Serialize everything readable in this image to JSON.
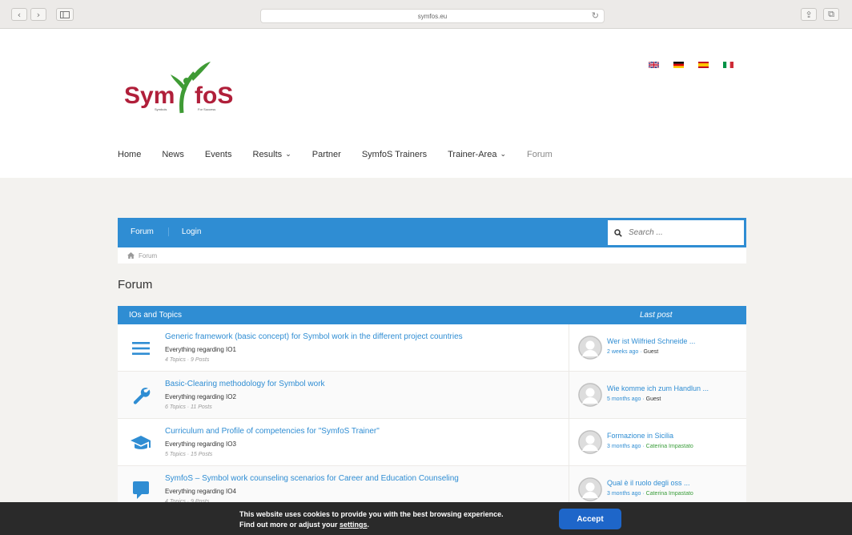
{
  "browser": {
    "url": "symfos.eu",
    "back_glyph": "‹",
    "forward_glyph": "›",
    "reload_glyph": "↻",
    "share_glyph": "⇪",
    "tabs_glyph": "⧉"
  },
  "brand": {
    "logo_text": "SymfoS",
    "logo_sub_left": "Symbols",
    "logo_sub_right": "For Success",
    "colors": {
      "red": "#b01f3a",
      "green": "#3f9b35",
      "accent": "#2f8dd3"
    }
  },
  "languages": [
    "en",
    "de",
    "es",
    "it"
  ],
  "nav": {
    "items": [
      {
        "label": "Home"
      },
      {
        "label": "News"
      },
      {
        "label": "Events"
      },
      {
        "label": "Results",
        "dropdown": true
      },
      {
        "label": "Partner"
      },
      {
        "label": "SymfoS Trainers"
      },
      {
        "label": "Trainer-Area",
        "dropdown": true
      },
      {
        "label": "Forum",
        "active": true
      }
    ]
  },
  "forum": {
    "bar_links": [
      "Forum",
      "Login"
    ],
    "search_placeholder": "Search ...",
    "breadcrumb": "Forum",
    "page_title": "Forum",
    "table_head": {
      "topics": "IOs and Topics",
      "last_post": "Last post"
    },
    "rows": [
      {
        "icon": "list-icon",
        "title": "Generic framework (basic concept) for Symbol work in the different project countries",
        "desc": "Everything regarding IO1",
        "meta": "4 Topics · 9 Posts",
        "lp_title": "Wer ist Wilfried Schneide ...",
        "lp_time": "2 weeks ago",
        "lp_author": "Guest",
        "author_is_user": false
      },
      {
        "icon": "wrench-icon",
        "title": "Basic-Clearing methodology for Symbol work",
        "desc": "Everything regarding IO2",
        "meta": "6 Topics · 11 Posts",
        "lp_title": "Wie komme ich zum Handlun ...",
        "lp_time": "5 months ago",
        "lp_author": "Guest",
        "author_is_user": false
      },
      {
        "icon": "graduation-cap-icon",
        "title": "Curriculum and Profile of competencies for \"SymfoS Trainer\"",
        "desc": "Everything regarding IO3",
        "meta": "5 Topics · 15 Posts",
        "lp_title": "Formazione in Sicilia",
        "lp_time": "3 months ago",
        "lp_author": "Caterina Impastato",
        "author_is_user": true
      },
      {
        "icon": "comment-icon",
        "title": "SymfoS – Symbol work counseling scenarios for Career and Education Counseling",
        "desc": "Everything regarding IO4",
        "meta": "4 Topics · 9 Posts",
        "lp_title": "Qual è il ruolo degli oss ...",
        "lp_time": "3 months ago",
        "lp_author": "Caterina Impastato",
        "author_is_user": true
      }
    ]
  },
  "cookie": {
    "line1": "This website uses cookies to provide you with the best browsing experience.",
    "line2_prefix": "Find out more or adjust your ",
    "line2_link": "settings",
    "line2_suffix": ".",
    "accept_label": "Accept"
  }
}
